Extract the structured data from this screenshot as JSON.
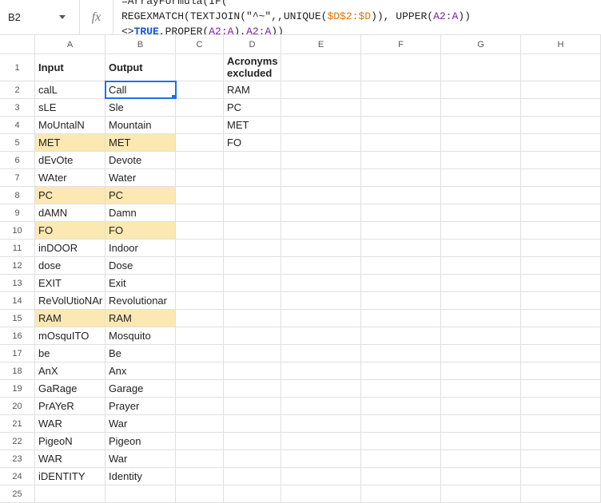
{
  "name_box": "B2",
  "fx_label": "fx",
  "formula": {
    "line1_pre": "=ArrayFormula(IF(",
    "line2_a": "REGEXMATCH(TEXTJOIN(\"^~\",,UNIQUE(",
    "line2_range": "$D$2:$D",
    "line2_b": ")), UPPER(",
    "line2_ref1": "A2:A",
    "line2_c": "))<>",
    "line2_true": "TRUE",
    "line2_d": ",PROPER(",
    "line2_ref2": "A2:A",
    "line2_e": "),",
    "line2_ref3": "A2:A",
    "line2_f": "))"
  },
  "columns": [
    "A",
    "B",
    "C",
    "D",
    "E",
    "F",
    "G",
    "H"
  ],
  "headers": {
    "A": "Input",
    "B": "Output",
    "D": "Acronyms excluded"
  },
  "rows": [
    {
      "n": 2,
      "A": "calL",
      "B": "Call",
      "D": "RAM",
      "active": true
    },
    {
      "n": 3,
      "A": "sLE",
      "B": "Sle",
      "D": "PC"
    },
    {
      "n": 4,
      "A": "MoUntalN",
      "B": "Mountain",
      "D": "MET"
    },
    {
      "n": 5,
      "A": "MET",
      "B": "MET",
      "D": "FO",
      "hl": true
    },
    {
      "n": 6,
      "A": "dEvOte",
      "B": "Devote"
    },
    {
      "n": 7,
      "A": "WAter",
      "B": "Water"
    },
    {
      "n": 8,
      "A": "PC",
      "B": "PC",
      "hl": true
    },
    {
      "n": 9,
      "A": "dAMN",
      "B": "Damn"
    },
    {
      "n": 10,
      "A": "FO",
      "B": "FO",
      "hl": true
    },
    {
      "n": 11,
      "A": "inDOOR",
      "B": "Indoor"
    },
    {
      "n": 12,
      "A": "dose",
      "B": "Dose"
    },
    {
      "n": 13,
      "A": "EXIT",
      "B": "Exit"
    },
    {
      "n": 14,
      "A": "ReVolUtioNAr",
      "B": "Revolutionar"
    },
    {
      "n": 15,
      "A": "RAM",
      "B": "RAM",
      "hl": true
    },
    {
      "n": 16,
      "A": "mOsquITO",
      "B": "Mosquito"
    },
    {
      "n": 17,
      "A": "be",
      "B": "Be"
    },
    {
      "n": 18,
      "A": "AnX",
      "B": "Anx"
    },
    {
      "n": 19,
      "A": "GaRage",
      "B": "Garage"
    },
    {
      "n": 20,
      "A": "PrAYeR",
      "B": "Prayer"
    },
    {
      "n": 21,
      "A": "WAR",
      "B": "War"
    },
    {
      "n": 22,
      "A": "PigeoN",
      "B": "Pigeon"
    },
    {
      "n": 23,
      "A": "WAR",
      "B": "War"
    },
    {
      "n": 24,
      "A": "iDENTITY",
      "B": "Identity"
    },
    {
      "n": 25
    }
  ]
}
